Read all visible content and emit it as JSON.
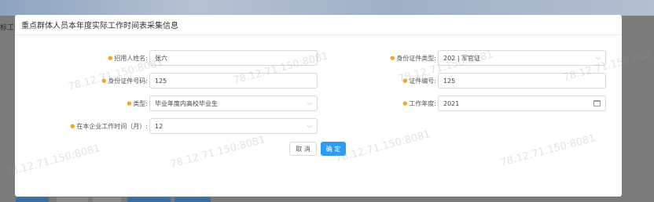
{
  "background": {
    "side_text": "标工作"
  },
  "dialog": {
    "title": "重点群体人员本年度实际工作时间表采集信息",
    "fields": {
      "name": {
        "label": "招用人姓名",
        "value": "张六"
      },
      "id_type": {
        "label": "身份证件类型",
        "value": "202 | 军官证"
      },
      "id_number": {
        "label": "身份证件号码",
        "value": "125"
      },
      "cert_number": {
        "label": "证件编号",
        "value": "125"
      },
      "type": {
        "label": "类型",
        "value": "毕业年度内高校毕业生"
      },
      "work_year": {
        "label": "工作年度",
        "value": "2021"
      },
      "months": {
        "label": "在本企业工作时间（月）",
        "value": "12"
      }
    },
    "buttons": {
      "cancel": "取 消",
      "ok": "确 定"
    }
  },
  "watermark": "78.12.71.150:8081",
  "colors": {
    "primary": "#2d9cf4",
    "required": "#f5a623"
  }
}
